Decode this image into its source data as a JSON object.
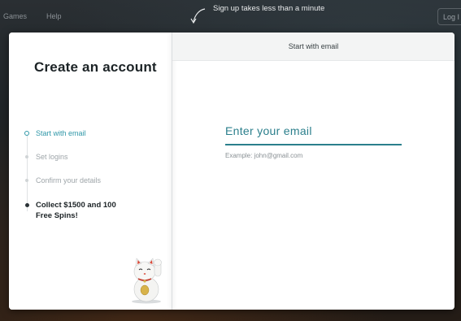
{
  "nav": {
    "games_label": "Games",
    "help_label": "Help",
    "login_label": "Log I"
  },
  "hint": {
    "text": "Sign up takes less than a minute",
    "icon": "curved-arrow-icon"
  },
  "modal": {
    "title": "Create an account",
    "steps": [
      {
        "label": "Start with email",
        "state": "active"
      },
      {
        "label": "Set logins",
        "state": "pending"
      },
      {
        "label": "Confirm your details",
        "state": "pending"
      },
      {
        "label": "Collect $1500 and 100 Free Spins!",
        "state": "reward"
      }
    ],
    "mascot_icon": "lucky-cat-icon",
    "header_label": "Start with email",
    "email": {
      "label": "Enter your email",
      "example": "Example: john@gmail.com",
      "value": ""
    }
  },
  "colors": {
    "accent": "#2f97a8",
    "field_underline": "#2b7f8c",
    "title_text": "#1c2326"
  }
}
